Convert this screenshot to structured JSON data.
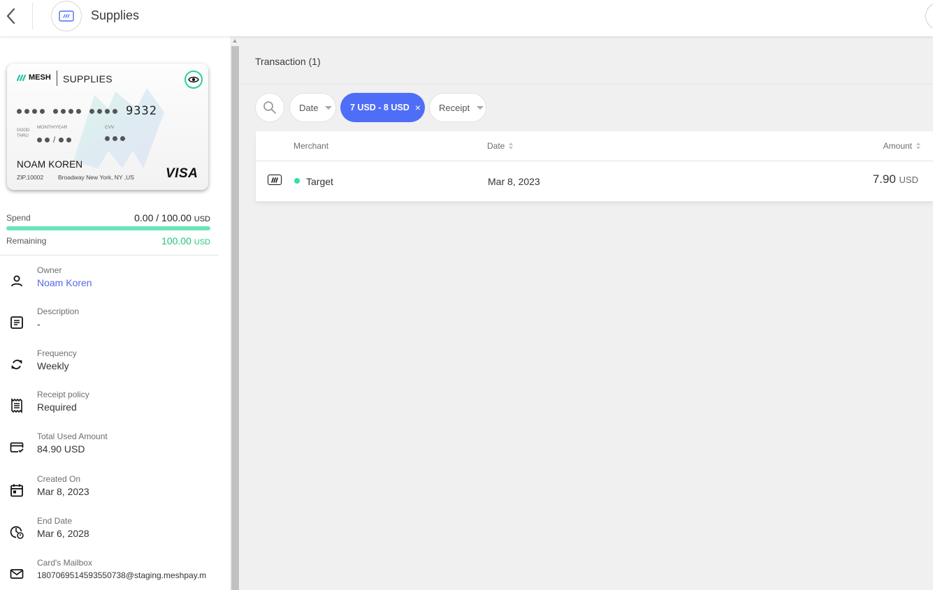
{
  "header": {
    "title": "Supplies"
  },
  "card": {
    "brand": "MESH",
    "name": "SUPPLIES",
    "last4": "9332",
    "good_thru": "GOOD THRU",
    "month_year_label": "MONTH/YEAR",
    "cvv_label": "CVV",
    "holder": "NOAM KOREN",
    "zip": "ZIP.10002",
    "address": "Broadway New York, NY ,US",
    "network": "VISA",
    "colors": {
      "accent": "#25d48f"
    }
  },
  "spend": {
    "label": "Spend",
    "value": "0.00 / 100.00",
    "unit": "USD",
    "progress_fraction": 1.0,
    "remaining_label": "Remaining",
    "remaining_value": "100.00",
    "remaining_unit": "USD"
  },
  "details": [
    {
      "icon": "person-icon",
      "label": "Owner",
      "value": "Noam Koren"
    },
    {
      "icon": "description-icon",
      "label": "Description",
      "value": "-"
    },
    {
      "icon": "repeat-icon",
      "label": "Frequency",
      "value": "Weekly"
    },
    {
      "icon": "receipt-icon",
      "label": "Receipt policy",
      "value": "Required"
    },
    {
      "icon": "card-check-icon",
      "label": "Total Used Amount",
      "value": "84.90 USD"
    },
    {
      "icon": "calendar-icon",
      "label": "Created On",
      "value": "Mar 8, 2023"
    },
    {
      "icon": "clock-icon",
      "label": "End Date",
      "value": "Mar 6, 2028"
    },
    {
      "icon": "mail-icon",
      "label": "Card's Mailbox",
      "value": "1807069514593550738@staging.meshpay.m"
    }
  ],
  "transactions": {
    "title": "Transaction (1)",
    "filters": {
      "date_label": "Date",
      "amount_label": "7 USD - 8 USD",
      "receipt_label": "Receipt"
    },
    "columns": {
      "merchant": "Merchant",
      "date": "Date",
      "amount": "Amount"
    },
    "rows": [
      {
        "merchant": "Target",
        "date": "Mar 8, 2023",
        "amount": "7.90",
        "unit": "USD",
        "status_color": "#2ee39d"
      }
    ]
  }
}
